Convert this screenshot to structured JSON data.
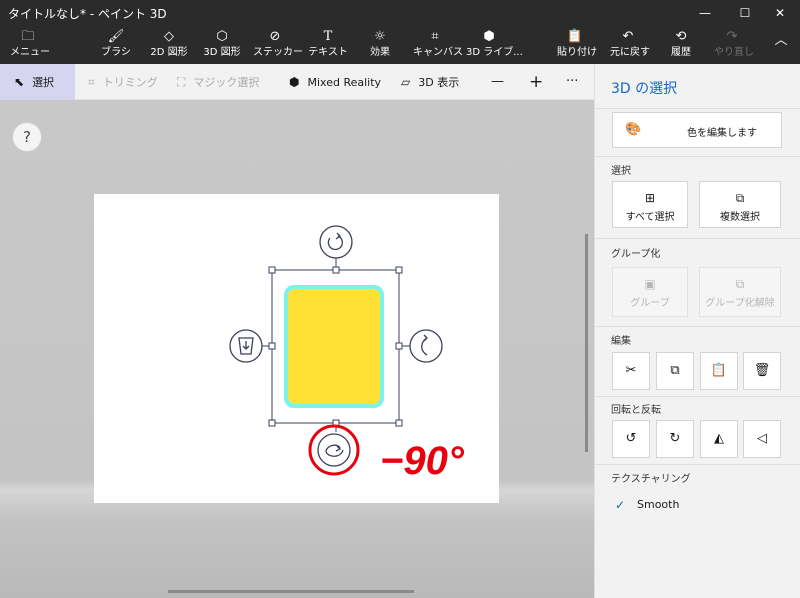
{
  "window": {
    "title": "タイトルなし* - ペイント 3D",
    "minimize": "—",
    "maximize": "☐",
    "close": "✕"
  },
  "toolbar": {
    "menu": "メニュー",
    "brushes": "ブラシ",
    "shapes2d": "2D 図形",
    "shapes3d": "3D 図形",
    "stickers": "ステッカー",
    "text": "テキスト",
    "effects": "効果",
    "canvas": "キャンバス",
    "library3d": "3D ライブ...",
    "paste": "貼り付け",
    "undo": "元に戻す",
    "history": "履歴",
    "redo": "やり直し"
  },
  "subtoolbar": {
    "select": "選択",
    "trim": "トリミング",
    "magic_select": "マジック選択",
    "mixed_reality": "Mixed Reality",
    "view3d": "3D 表示",
    "zoom_out": "—",
    "zoom_in": "+",
    "more": "···"
  },
  "canvas": {
    "help": "?",
    "annotation": "−90°",
    "colors": {
      "shape_fill": "#ffe135",
      "shape_outline": "#7ff2e8",
      "annotation": "#e8000e",
      "handle": "#3a3f5c"
    }
  },
  "panel": {
    "title": "3D の選択",
    "edit_color": "色を編集します",
    "section_select": "選択",
    "select_all": "すべて選択",
    "multi_select": "複数選択",
    "section_group": "グループ化",
    "group": "グループ",
    "ungroup": "グループ化解除",
    "section_edit": "編集",
    "section_rotate_flip": "回転と反転",
    "section_texturing": "テクスチャリング",
    "smooth": "Smooth"
  }
}
